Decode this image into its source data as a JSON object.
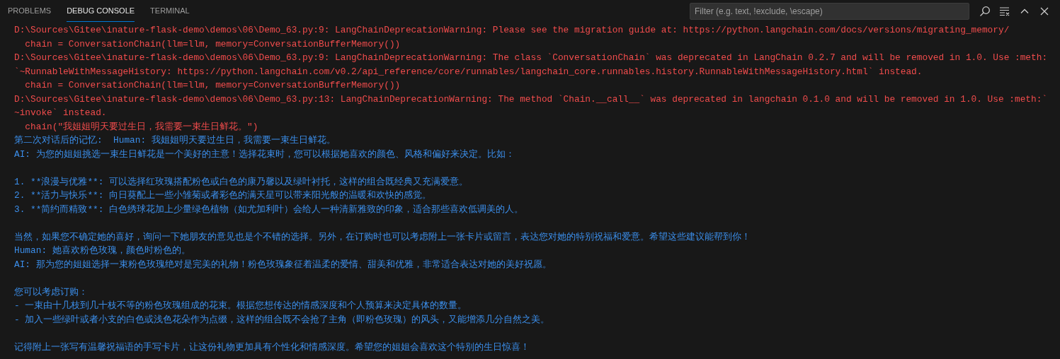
{
  "panel_tabs": [
    {
      "label": "PROBLEMS",
      "selected": false
    },
    {
      "label": "DEBUG CONSOLE",
      "selected": true
    },
    {
      "label": "TERMINAL",
      "selected": false
    }
  ],
  "filter": {
    "placeholder": "Filter (e.g. text, !exclude, \\escape)"
  },
  "console_lines": [
    {
      "kind": "error",
      "text": "D:\\Sources\\Gitee\\inature-flask-demo\\demos\\06\\Demo_63.py:9: LangChainDeprecationWarning: Please see the migration guide at: https://python.langchain.com/docs/versions/migrating_memory/"
    },
    {
      "kind": "error",
      "text": "  chain = ConversationChain(llm=llm, memory=ConversationBufferMemory())"
    },
    {
      "kind": "error",
      "text": "D:\\Sources\\Gitee\\inature-flask-demo\\demos\\06\\Demo_63.py:9: LangChainDeprecationWarning: The class `ConversationChain` was deprecated in LangChain 0.2.7 and will be removed in 1.0. Use :meth:"
    },
    {
      "kind": "error",
      "text": "`~RunnableWithMessageHistory: https://python.langchain.com/v0.2/api_reference/core/runnables/langchain_core.runnables.history.RunnableWithMessageHistory.html` instead."
    },
    {
      "kind": "error",
      "text": "  chain = ConversationChain(llm=llm, memory=ConversationBufferMemory())"
    },
    {
      "kind": "error",
      "text": "D:\\Sources\\Gitee\\inature-flask-demo\\demos\\06\\Demo_63.py:13: LangChainDeprecationWarning: The method `Chain.__call__` was deprecated in langchain 0.1.0 and will be removed in 1.0. Use :meth:`"
    },
    {
      "kind": "error",
      "text": "~invoke` instead."
    },
    {
      "kind": "error",
      "text": "  chain(\"我姐姐明天要过生日，我需要一束生日鲜花。\")"
    },
    {
      "kind": "output",
      "text": "第二次对话后的记忆:  Human: 我姐姐明天要过生日，我需要一束生日鲜花。"
    },
    {
      "kind": "output",
      "text": "AI: 为您的姐姐挑选一束生日鲜花是一个美好的主意！选择花束时，您可以根据她喜欢的颜色、风格和偏好来决定。比如："
    },
    {
      "kind": "blank"
    },
    {
      "kind": "output",
      "text": "1. **浪漫与优雅**: 可以选择红玫瑰搭配粉色或白色的康乃馨以及绿叶衬托，这样的组合既经典又充满爱意。"
    },
    {
      "kind": "output",
      "text": "2. **活力与快乐**: 向日葵配上一些小雏菊或者彩色的满天星可以带来阳光般的温暖和欢快的感觉。"
    },
    {
      "kind": "output",
      "text": "3. **简约而精致**: 白色绣球花加上少量绿色植物（如尤加利叶）会给人一种清新雅致的印象，适合那些喜欢低调美的人。"
    },
    {
      "kind": "blank"
    },
    {
      "kind": "output",
      "text": "当然，如果您不确定她的喜好，询问一下她朋友的意见也是个不错的选择。另外，在订购时也可以考虑附上一张卡片或留言，表达您对她的特别祝福和爱意。希望这些建议能帮到你！"
    },
    {
      "kind": "output",
      "text": "Human: 她喜欢粉色玫瑰，颜色时粉色的。"
    },
    {
      "kind": "output",
      "text": "AI: 那为您的姐姐选择一束粉色玫瑰绝对是完美的礼物！粉色玫瑰象征着温柔的爱情、甜美和优雅，非常适合表达对她的美好祝愿。"
    },
    {
      "kind": "blank"
    },
    {
      "kind": "output",
      "text": "您可以考虑订购："
    },
    {
      "kind": "output",
      "text": "- 一束由十几枝到几十枝不等的粉色玫瑰组成的花束。根据您想传达的情感深度和个人预算来决定具体的数量。"
    },
    {
      "kind": "output",
      "text": "- 加入一些绿叶或者小支的白色或浅色花朵作为点缀，这样的组合既不会抢了主角（即粉色玫瑰）的风头，又能增添几分自然之美。"
    },
    {
      "kind": "blank"
    },
    {
      "kind": "output",
      "text": "记得附上一张写有温馨祝福语的手写卡片，让这份礼物更加具有个性化和情感深度。希望您的姐姐会喜欢这个特别的生日惊喜！"
    }
  ]
}
